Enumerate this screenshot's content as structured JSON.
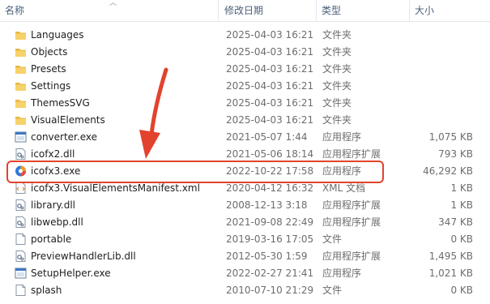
{
  "columns": {
    "name": "名称",
    "date": "修改日期",
    "type": "类型",
    "size": "大小"
  },
  "files": [
    {
      "icon": "folder-icon",
      "name": "Languages",
      "date": "2025-04-03 16:21",
      "type": "文件夹",
      "size": ""
    },
    {
      "icon": "folder-icon",
      "name": "Objects",
      "date": "2025-04-03 16:21",
      "type": "文件夹",
      "size": ""
    },
    {
      "icon": "folder-icon",
      "name": "Presets",
      "date": "2025-04-03 16:21",
      "type": "文件夹",
      "size": ""
    },
    {
      "icon": "folder-icon",
      "name": "Settings",
      "date": "2025-04-03 16:21",
      "type": "文件夹",
      "size": ""
    },
    {
      "icon": "folder-icon",
      "name": "ThemesSVG",
      "date": "2025-04-03 16:21",
      "type": "文件夹",
      "size": ""
    },
    {
      "icon": "folder-icon",
      "name": "VisualElements",
      "date": "2025-04-03 16:21",
      "type": "文件夹",
      "size": ""
    },
    {
      "icon": "exe-icon",
      "name": "converter.exe",
      "date": "2021-05-07 1:44",
      "type": "应用程序",
      "size": "1,075 KB"
    },
    {
      "icon": "dll-icon",
      "name": "icofx2.dll",
      "date": "2021-05-06 18:14",
      "type": "应用程序扩展",
      "size": "793 KB"
    },
    {
      "icon": "icofx-app-icon",
      "name": "icofx3.exe",
      "date": "2022-10-22 17:58",
      "type": "应用程序",
      "size": "46,292 KB"
    },
    {
      "icon": "xml-icon",
      "name": "icofx3.VisualElementsManifest.xml",
      "date": "2020-04-12 16:32",
      "type": "XML 文档",
      "size": "1 KB"
    },
    {
      "icon": "dll-icon",
      "name": "library.dll",
      "date": "2008-12-13 3:18",
      "type": "应用程序扩展",
      "size": "1 KB"
    },
    {
      "icon": "dll-icon",
      "name": "libwebp.dll",
      "date": "2021-09-08 22:49",
      "type": "应用程序扩展",
      "size": "347 KB"
    },
    {
      "icon": "file-icon",
      "name": "portable",
      "date": "2019-03-16 17:05",
      "type": "文件",
      "size": "0 KB"
    },
    {
      "icon": "dll-icon",
      "name": "PreviewHandlerLib.dll",
      "date": "2012-05-30 1:59",
      "type": "应用程序扩展",
      "size": "1,495 KB"
    },
    {
      "icon": "exe-icon",
      "name": "SetupHelper.exe",
      "date": "2022-02-27 21:41",
      "type": "应用程序",
      "size": "1,021 KB"
    },
    {
      "icon": "file-icon",
      "name": "splash",
      "date": "2010-07-10 21:29",
      "type": "文件",
      "size": "0 KB"
    }
  ],
  "annotation": {
    "color": "#e2432e",
    "highlighted_file": "icofx3.exe"
  }
}
